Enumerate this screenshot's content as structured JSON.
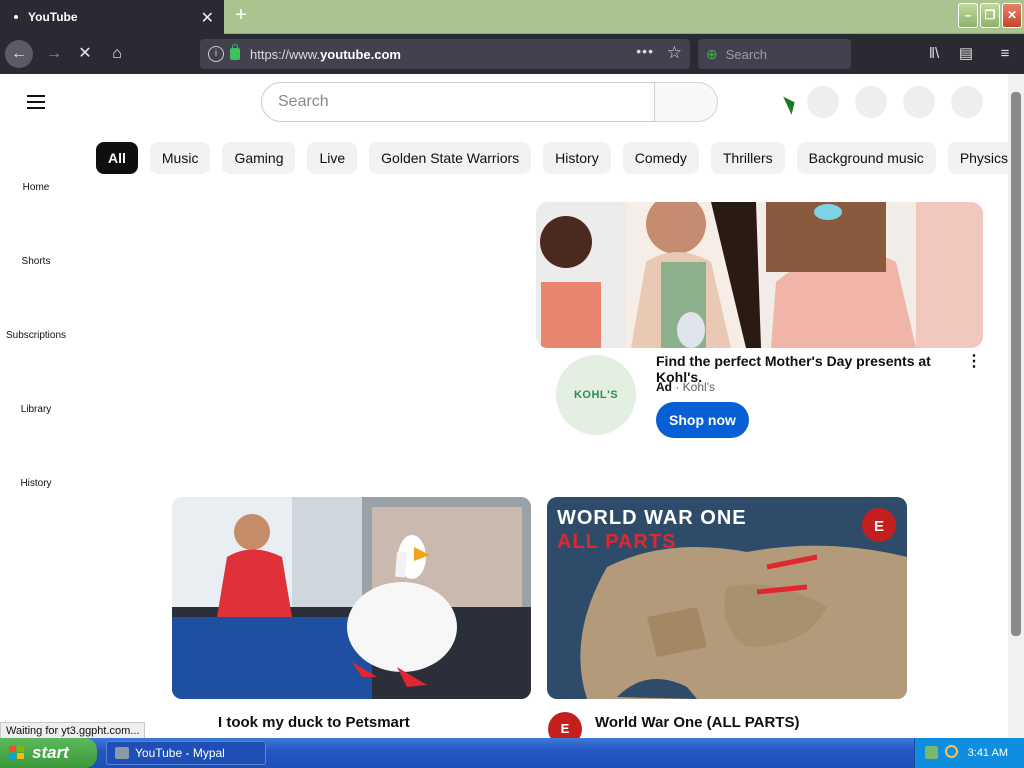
{
  "browser": {
    "tab_title": "YouTube",
    "url_prefix": "https://www.",
    "url_domain": "youtube.com",
    "search_placeholder": "Search",
    "status_text": "Waiting for yt3.ggpht.com..."
  },
  "yt": {
    "search_placeholder": "Search",
    "chips": [
      "All",
      "Music",
      "Gaming",
      "Live",
      "Golden State Warriors",
      "History",
      "Comedy",
      "Thrillers",
      "Background music",
      "Physics"
    ],
    "sidebar": [
      "Home",
      "Shorts",
      "Subscriptions",
      "Library",
      "History"
    ],
    "ad": {
      "title": "Find the perfect Mother's Day presents at Kohl's.",
      "badge": "Ad",
      "advertiser": "Kohl's",
      "logo_text": "KOHL'S",
      "button": "Shop now"
    },
    "videos": [
      {
        "title": "I took my duck to Petsmart"
      },
      {
        "title": "World War One (ALL PARTS)",
        "thumb_line1": "WORLD WAR ONE",
        "thumb_line2": "ALL PARTS"
      }
    ]
  },
  "taskbar": {
    "start": "start",
    "item": "YouTube - Mypal",
    "clock": "3:41 AM"
  },
  "colors": {
    "accent": "#065fd4",
    "chip_active": "#0f0f0f",
    "taskbar": "#2557c4",
    "start": "#3a9a3a"
  }
}
